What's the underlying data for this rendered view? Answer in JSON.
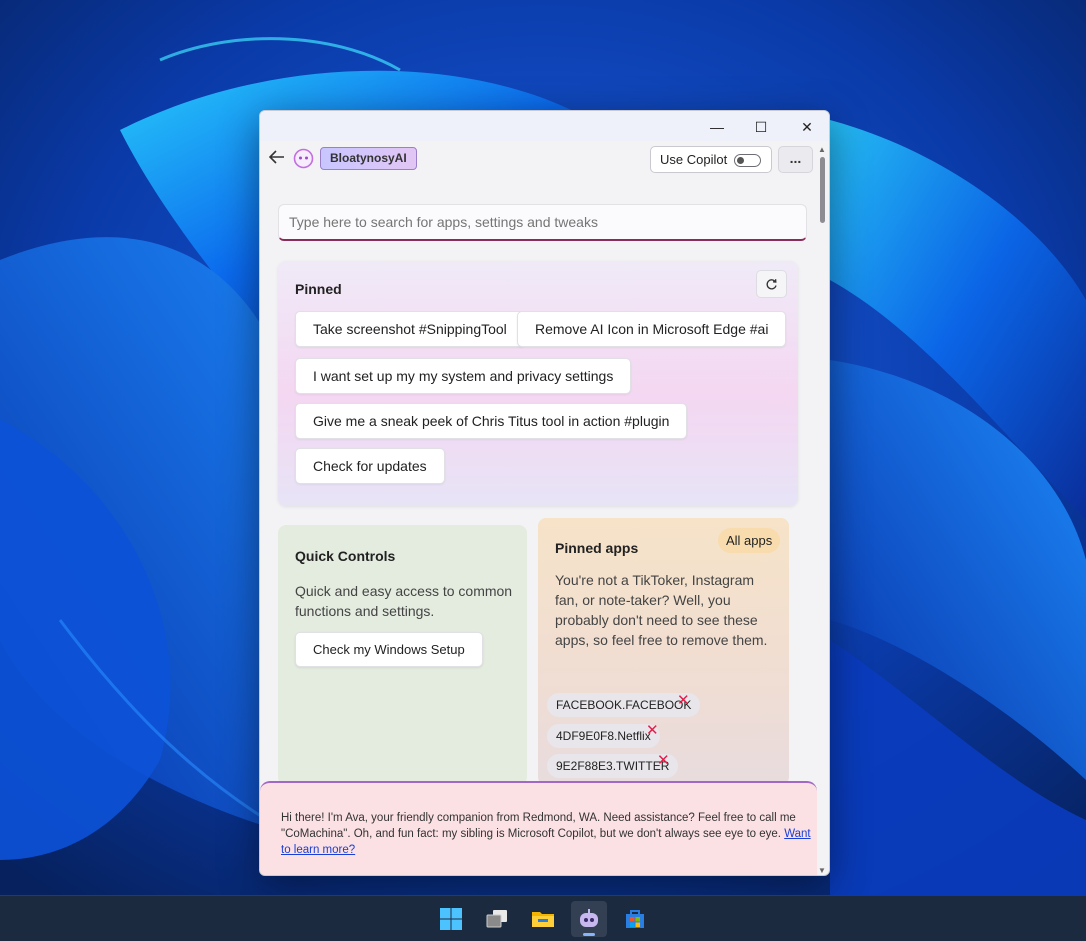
{
  "window": {
    "minimize_glyph": "—",
    "maximize_glyph": "☐",
    "close_glyph": "✕"
  },
  "header": {
    "back_icon": "arrow-left-icon",
    "logo_icon": "smiley-robot-icon",
    "brand": "BloatynosyAI",
    "copilot_label": "Use Copilot",
    "copilot_enabled": false,
    "more_label": "..."
  },
  "search": {
    "placeholder": "Type here to search for apps, settings and tweaks",
    "value": ""
  },
  "pinned": {
    "title": "Pinned",
    "refresh_icon": "refresh-icon",
    "items": [
      "Take screenshot #SnippingTool",
      "Remove AI Icon in Microsoft Edge #ai",
      "I want set up my my system and privacy settings",
      "Give me a sneak peek of Chris Titus tool in action #plugin",
      "Check for updates"
    ]
  },
  "quick_controls": {
    "title": "Quick Controls",
    "description": "Quick and easy access to common functions and settings.",
    "button": "Check my Windows Setup"
  },
  "pinned_apps": {
    "title": "Pinned apps",
    "all_apps": "All apps",
    "description": "You're not a TikToker, Instagram fan, or note-taker? Well, you probably don't need to see these apps, so feel free to remove them.",
    "apps": [
      "FACEBOOK.FACEBOOK",
      "4DF9E0F8.Netflix",
      "9E2F88E3.TWITTER"
    ],
    "remove_glyph": "✕"
  },
  "chat": {
    "message": "Hi there! I'm Ava, your friendly companion from Redmond, WA. Need assistance? Feel free to call me \"CoMachina\". Oh, and fun fact: my sibling is Microsoft Copilot, but we don't always see eye to eye.",
    "link": "Want to learn more?"
  },
  "taskbar": {
    "icons": [
      "windows-start-icon",
      "task-view-icon",
      "file-explorer-icon",
      "bloatynosy-app-icon",
      "microsoft-store-icon"
    ],
    "active_icon": "bloatynosy-app-icon"
  },
  "colors": {
    "accent_underline": "#8a2c5a",
    "brand_badge": "#c8c6ff",
    "remove_x": "#e0204a",
    "link": "#1a3fd6"
  }
}
